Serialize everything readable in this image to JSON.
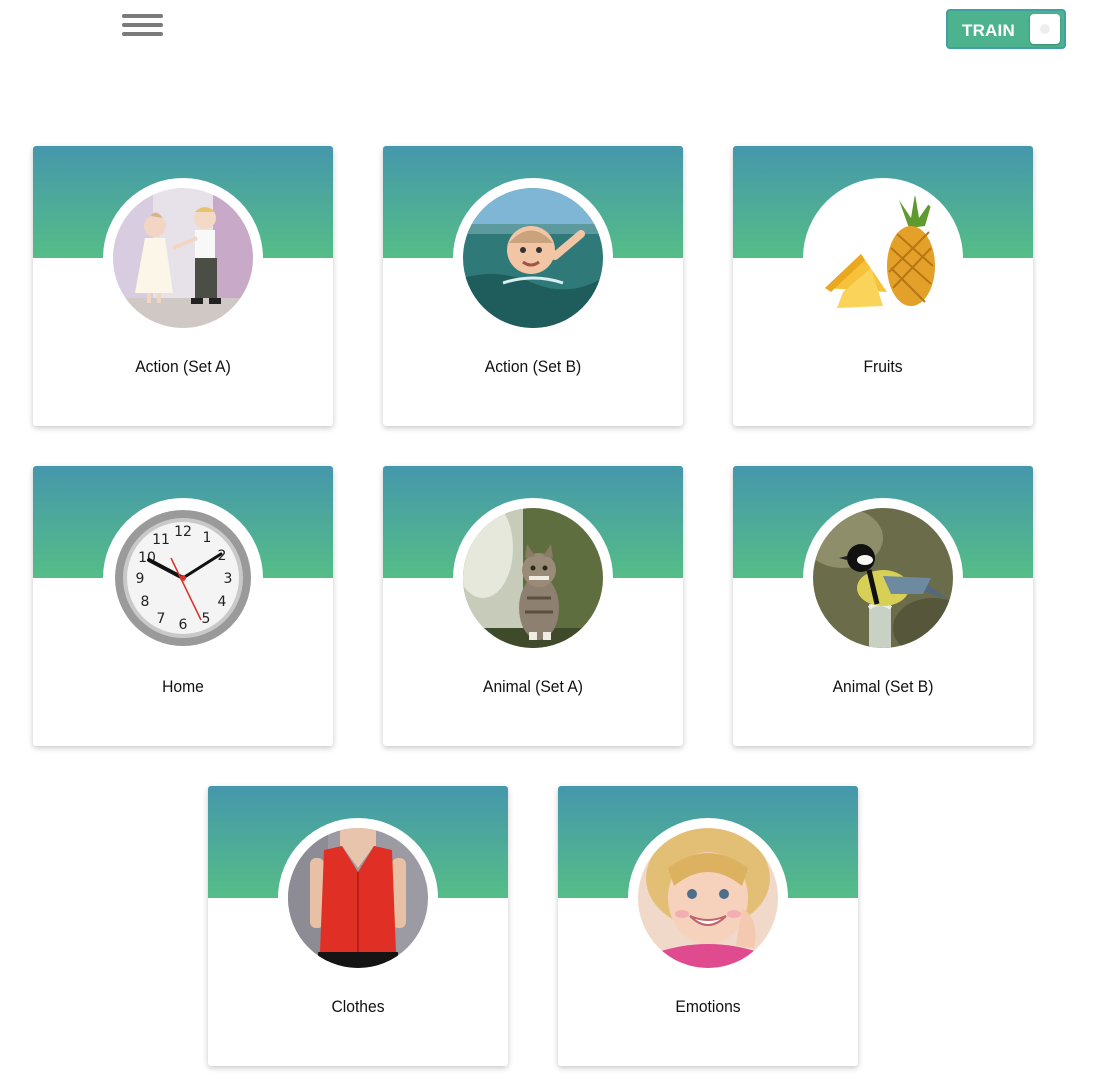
{
  "header": {
    "menu_icon": "hamburger-menu-icon",
    "toggle": {
      "label": "TRAIN",
      "state": "off"
    }
  },
  "categories": [
    {
      "title": "Action (Set A)",
      "image": "children-dancing-photo"
    },
    {
      "title": "Action (Set B)",
      "image": "baby-swimming-photo"
    },
    {
      "title": "Fruits",
      "image": "pineapple-photo"
    },
    {
      "title": "Home",
      "image": "wall-clock-photo"
    },
    {
      "title": "Animal (Set A)",
      "image": "cat-photo"
    },
    {
      "title": "Animal (Set B)",
      "image": "bird-photo"
    },
    {
      "title": "Clothes",
      "image": "red-blouse-photo"
    },
    {
      "title": "Emotions",
      "image": "smiling-girl-photo"
    }
  ],
  "colors": {
    "banner_top": "#4597ab",
    "banner_bottom": "#55bd87",
    "toggle_bg": "#4db38e"
  }
}
